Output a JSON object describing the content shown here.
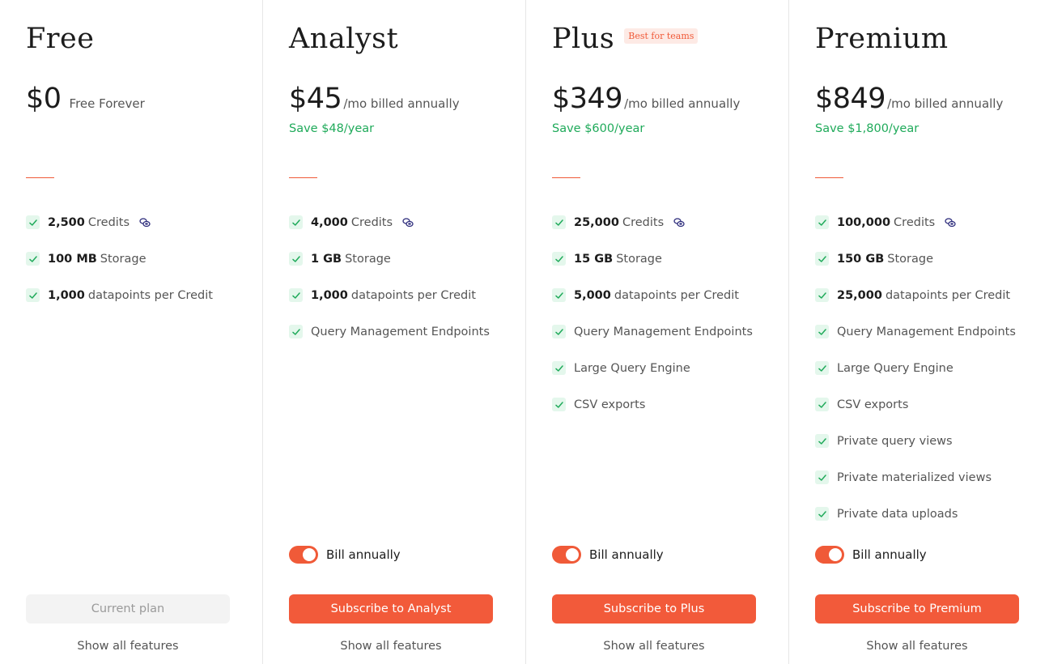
{
  "plans": [
    {
      "name": "Free",
      "badge": "",
      "price": "$0",
      "period": "Free Forever",
      "save": "",
      "features": [
        {
          "bold": "2,500",
          "text": "Credits",
          "coin": true
        },
        {
          "bold": "100 MB",
          "text": "Storage",
          "coin": false
        },
        {
          "bold": "1,000",
          "text": "datapoints per Credit",
          "coin": false
        }
      ],
      "toggle_label": "",
      "cta": "Current plan",
      "show_all": "Show all features"
    },
    {
      "name": "Analyst",
      "badge": "",
      "price": "$45",
      "period": "/mo billed annually",
      "save": "Save $48/year",
      "features": [
        {
          "bold": "4,000",
          "text": "Credits",
          "coin": true
        },
        {
          "bold": "1 GB",
          "text": "Storage",
          "coin": false
        },
        {
          "bold": "1,000",
          "text": "datapoints per Credit",
          "coin": false
        },
        {
          "bold": "",
          "text": "Query Management Endpoints",
          "coin": false
        }
      ],
      "toggle_label": "Bill annually",
      "cta": "Subscribe to Analyst",
      "show_all": "Show all features"
    },
    {
      "name": "Plus",
      "badge": "Best for teams",
      "price": "$349",
      "period": "/mo billed annually",
      "save": "Save $600/year",
      "features": [
        {
          "bold": "25,000",
          "text": "Credits",
          "coin": true
        },
        {
          "bold": "15 GB",
          "text": "Storage",
          "coin": false
        },
        {
          "bold": "5,000",
          "text": "datapoints per Credit",
          "coin": false
        },
        {
          "bold": "",
          "text": "Query Management Endpoints",
          "coin": false
        },
        {
          "bold": "",
          "text": "Large Query Engine",
          "coin": false
        },
        {
          "bold": "",
          "text": "CSV exports",
          "coin": false
        }
      ],
      "toggle_label": "Bill annually",
      "cta": "Subscribe to Plus",
      "show_all": "Show all features"
    },
    {
      "name": "Premium",
      "badge": "",
      "price": "$849",
      "period": "/mo billed annually",
      "save": "Save $1,800/year",
      "features": [
        {
          "bold": "100,000",
          "text": "Credits",
          "coin": true
        },
        {
          "bold": "150 GB",
          "text": "Storage",
          "coin": false
        },
        {
          "bold": "25,000",
          "text": "datapoints per Credit",
          "coin": false
        },
        {
          "bold": "",
          "text": "Query Management Endpoints",
          "coin": false
        },
        {
          "bold": "",
          "text": "Large Query Engine",
          "coin": false
        },
        {
          "bold": "",
          "text": "CSV exports",
          "coin": false
        },
        {
          "bold": "",
          "text": "Private query views",
          "coin": false
        },
        {
          "bold": "",
          "text": "Private materialized views",
          "coin": false
        },
        {
          "bold": "",
          "text": "Private data uploads",
          "coin": false
        }
      ],
      "toggle_label": "Bill annually",
      "cta": "Subscribe to Premium",
      "show_all": "Show all features"
    }
  ],
  "colors": {
    "accent": "#f25a3a",
    "save_green": "#1faa5a",
    "check_bg": "#e4f7ec",
    "check_mark": "#1faa5a",
    "badge_bg": "#fdeae5"
  },
  "icons": {
    "check": "check-icon",
    "coin": "credits-coin-icon"
  }
}
